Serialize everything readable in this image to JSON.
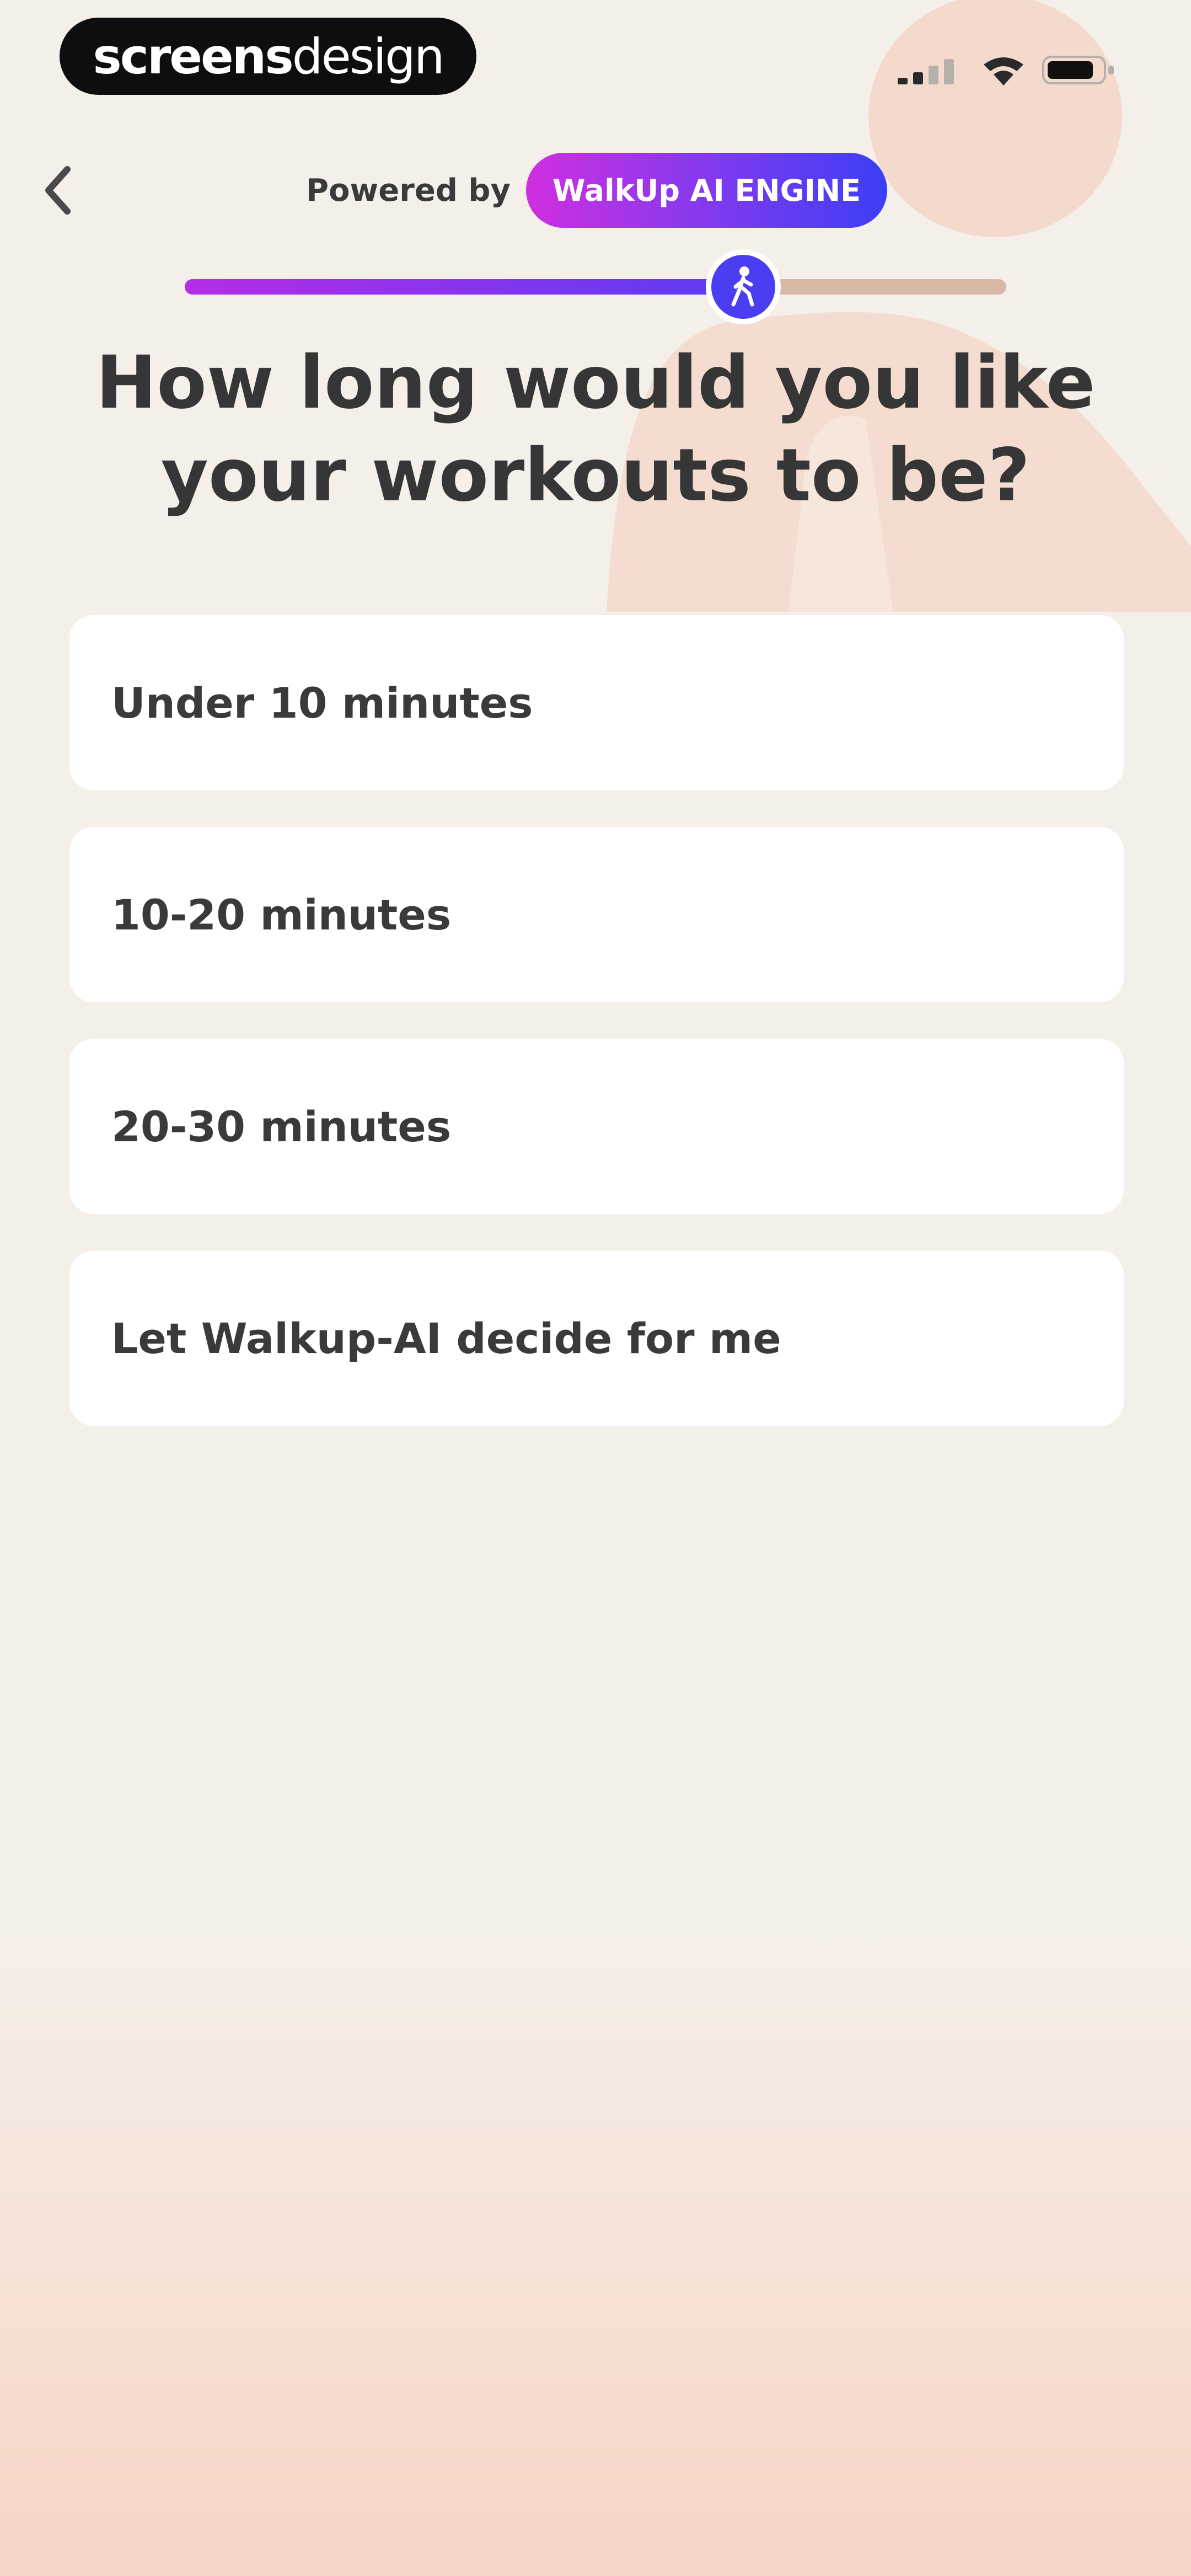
{
  "branding": {
    "part1": "screens",
    "part2": "design"
  },
  "status_bar": {
    "icons": [
      "signal-icon",
      "wifi-icon",
      "battery-icon"
    ]
  },
  "header": {
    "back_icon": "chevron-left-icon",
    "powered_by_label": "Powered by",
    "engine_badge": "WalkUp AI ENGINE"
  },
  "progress": {
    "fraction": 0.68,
    "knob_icon": "walking-figure-icon"
  },
  "question": "How long would you like your workouts to be?",
  "options": [
    {
      "label": "Under 10 minutes"
    },
    {
      "label": "10-20 minutes"
    },
    {
      "label": "20-30 minutes"
    },
    {
      "label": "Let Walkup-AI decide for me"
    }
  ],
  "colors": {
    "background": "#f4f0e9",
    "background_bottom": "#f6d4c6",
    "accent_purple": "#cf2fe0",
    "accent_blue": "#3b3ff5",
    "decor_peach": "#f4d9cd",
    "text": "#363636"
  }
}
